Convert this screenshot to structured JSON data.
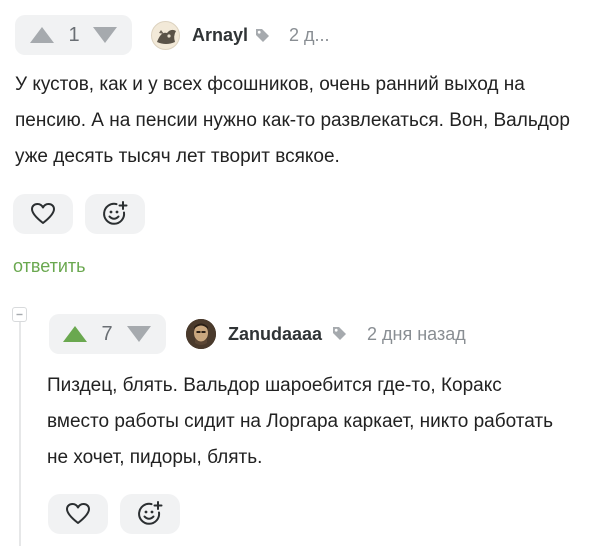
{
  "comments": [
    {
      "rating": "1",
      "author": "Arnayl",
      "time": "2 д...",
      "text": "У кустов, как и у всех фсошников, очень ранний выход на пенсию. А на пенсии нужно как-то развлекаться. Вон, Вальдор уже десять тысяч лет творит всякое.",
      "reply_label": "ответить",
      "upvoted": false
    },
    {
      "rating": "7",
      "author": "Zanudaaaa",
      "time": "2 дня назад",
      "text": "Пиздец, блять. Вальдор шароебится где-то, Коракс вместо работы сидит на Лоргара каркает, никто работать не хочет, пидоры, блять.",
      "upvoted": true
    }
  ],
  "colors": {
    "upvote_active": "#6aa84f",
    "arrow_inactive": "#a6aaae",
    "reply_link": "#6aa84f"
  },
  "icons": [
    "arrow-up-icon",
    "arrow-down-icon",
    "tag-icon",
    "heart-icon",
    "emoji-add-icon",
    "collapse-icon"
  ]
}
